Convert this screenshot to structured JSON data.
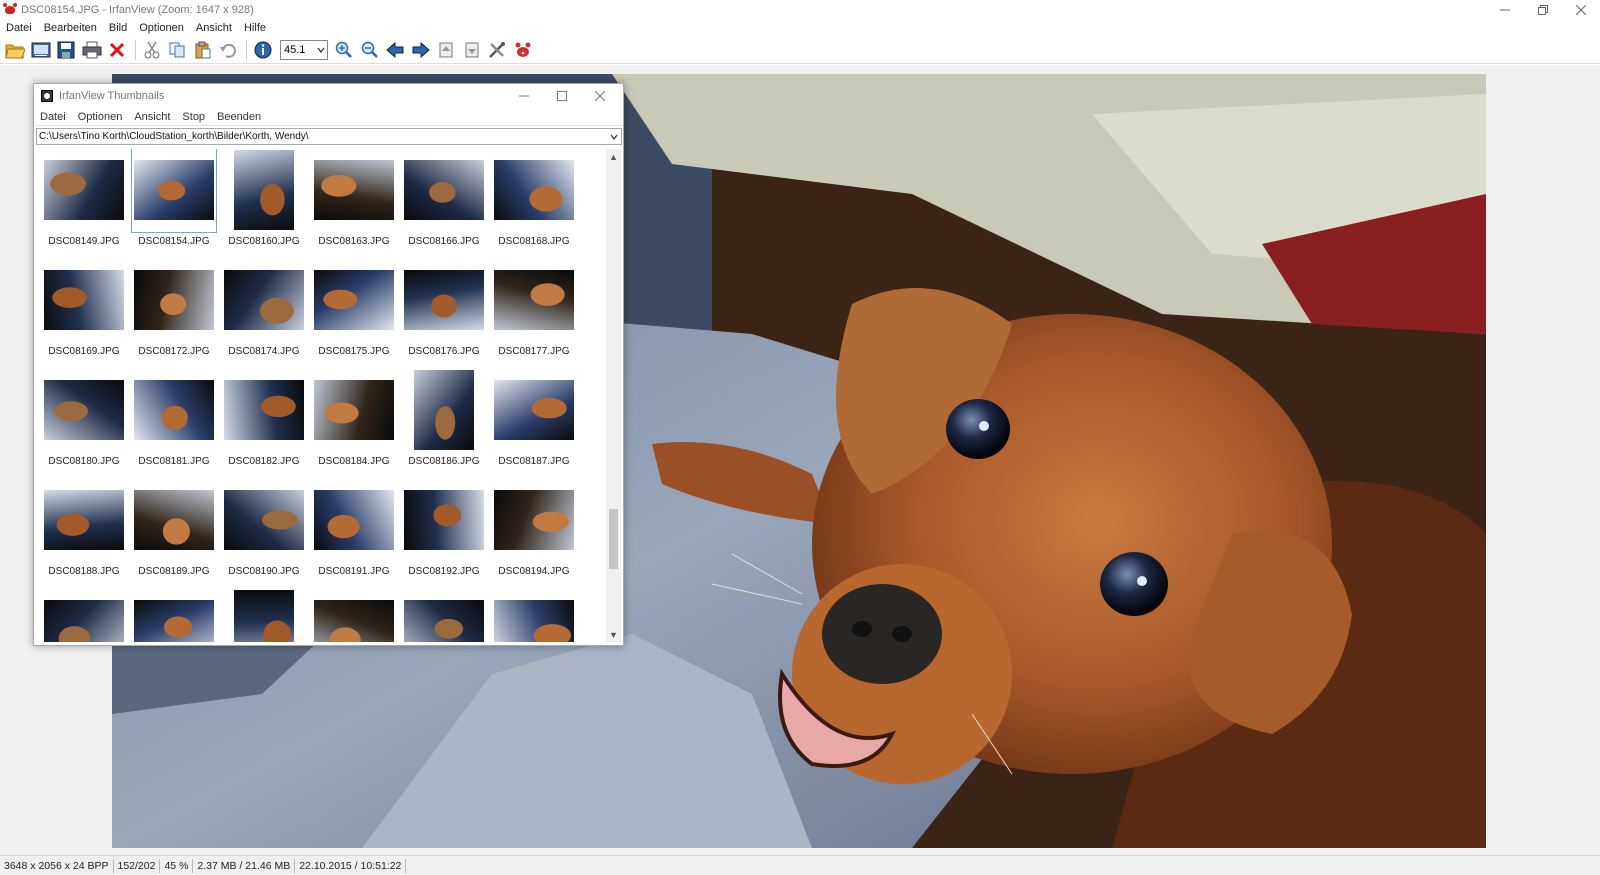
{
  "window": {
    "title": "DSC08154.JPG - IrfanView (Zoom: 1647 x 928)",
    "controls": [
      "minimize",
      "restore",
      "close"
    ]
  },
  "menubar": [
    "Datei",
    "Bearbeiten",
    "Bild",
    "Optionen",
    "Ansicht",
    "Hilfe"
  ],
  "toolbar": {
    "zoom_value": "45.1",
    "buttons": [
      "open-folder-icon",
      "slideshow-icon",
      "save-icon",
      "print-icon",
      "delete-icon",
      "cut-icon",
      "copy-icon",
      "paste-icon",
      "undo-icon",
      "info-icon",
      "zoom-in-icon",
      "zoom-out-icon",
      "previous-icon",
      "next-icon",
      "first-page-icon",
      "last-page-icon",
      "settings-icon",
      "irfanview-icon"
    ]
  },
  "thumbnails": {
    "title": "IrfanView Thumbnails",
    "menu": [
      "Datei",
      "Optionen",
      "Ansicht",
      "Stop",
      "Beenden"
    ],
    "path": "C:\\Users\\Tino Korth\\CloudStation_korth\\Bilder\\Korth, Wendy\\",
    "selected": "DSC08154.JPG",
    "items": [
      {
        "name": "DSC08149.JPG",
        "orientation": "landscape"
      },
      {
        "name": "DSC08154.JPG",
        "orientation": "landscape"
      },
      {
        "name": "DSC08160.JPG",
        "orientation": "portrait"
      },
      {
        "name": "DSC08163.JPG",
        "orientation": "landscape"
      },
      {
        "name": "DSC08166.JPG",
        "orientation": "landscape"
      },
      {
        "name": "DSC08168.JPG",
        "orientation": "landscape"
      },
      {
        "name": "DSC08169.JPG",
        "orientation": "landscape"
      },
      {
        "name": "DSC08172.JPG",
        "orientation": "landscape"
      },
      {
        "name": "DSC08174.JPG",
        "orientation": "landscape"
      },
      {
        "name": "DSC08175.JPG",
        "orientation": "landscape"
      },
      {
        "name": "DSC08176.JPG",
        "orientation": "landscape"
      },
      {
        "name": "DSC08177.JPG",
        "orientation": "landscape"
      },
      {
        "name": "DSC08180.JPG",
        "orientation": "landscape"
      },
      {
        "name": "DSC08181.JPG",
        "orientation": "landscape"
      },
      {
        "name": "DSC08182.JPG",
        "orientation": "landscape"
      },
      {
        "name": "DSC08184.JPG",
        "orientation": "landscape"
      },
      {
        "name": "DSC08186.JPG",
        "orientation": "portrait"
      },
      {
        "name": "DSC08187.JPG",
        "orientation": "landscape"
      },
      {
        "name": "DSC08188.JPG",
        "orientation": "landscape"
      },
      {
        "name": "DSC08189.JPG",
        "orientation": "landscape"
      },
      {
        "name": "DSC08190.JPG",
        "orientation": "landscape"
      },
      {
        "name": "DSC08191.JPG",
        "orientation": "landscape"
      },
      {
        "name": "DSC08192.JPG",
        "orientation": "landscape"
      },
      {
        "name": "DSC08194.JPG",
        "orientation": "landscape"
      }
    ]
  },
  "statusbar": {
    "dimensions": "3648 x 2056 x 24 BPP",
    "index": "152/202",
    "zoom": "45 %",
    "size": "2.37 MB / 21.46 MB",
    "datetime": "22.10.2015 / 10:51:22"
  },
  "colors": {
    "viewer_bg": "#f0f0f0",
    "dog_brown": "#a8582a",
    "blanket_blue": "#8fa0b8"
  }
}
